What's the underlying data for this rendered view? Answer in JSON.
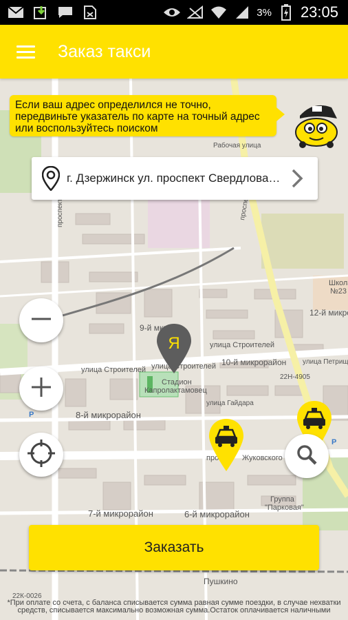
{
  "status_bar": {
    "battery": "3%",
    "time": "23:05",
    "icons": [
      "mail-icon",
      "download-icon",
      "sms-icon",
      "sim-icon",
      "eye-icon",
      "no-signal-icon",
      "wifi-icon",
      "signal-icon",
      "battery-charging-icon"
    ]
  },
  "app_bar": {
    "title": "Заказ такси",
    "menu_icon": "menu-icon"
  },
  "hint": {
    "lines": [
      "Если ваш адрес определился не точно,",
      "передвиньте указатель по карте на точный адрес",
      "или воспользуйтесь поиском"
    ]
  },
  "address": {
    "value": "г. Дзержинск ул. проспект Свердлова…"
  },
  "pin": {
    "letter": "Я"
  },
  "map_labels": {
    "street_stroiteley_1": "улица Строителей",
    "street_stroiteley_2": "улица Строителей",
    "street_stroiteley_3": "улица Строителей",
    "district_8": "8-й микрорайон",
    "district_7": "7-й микрорайон",
    "district_6": "6-й микрорайон",
    "district_9": "9-й мкр",
    "district_10": "10-й микрорайон",
    "district_12": "12-й микро",
    "stadium_1": "Стадион",
    "stadium_2": "Капролактамовец",
    "school_1": "Школа",
    "school_2": "№23",
    "group": "Группа",
    "group_name": "\"Парковая\"",
    "pushkino": "Пушкино",
    "road_22n_4905": "22Н-4905",
    "road_22k_0026": "22К-0026",
    "street_gaidara": "улица Гайдара",
    "street_petrishcheva": "улица Петрищева",
    "street_rabochaya": "Рабочая улица",
    "prospekt_left": "проспект",
    "prospekt_bottom": "просп",
    "prospekt_right": "проспект",
    "zhukovskogo": "Жуковского"
  },
  "buttons": {
    "zoom_out": "zoom-out-icon",
    "zoom_in": "zoom-in-icon",
    "locate": "crosshair-icon",
    "search": "search-icon"
  },
  "order": {
    "label": "Заказать"
  },
  "footnote": {
    "line1": "*При оплате со счета, с баланса списывается сумма равная сумме поездки, в случае нехватки",
    "line2": "средств, списывается максимально возможная сумма.Остаток оплачивается наличными"
  },
  "colors": {
    "accent": "#ffe100",
    "map_bg": "#e8e4dc",
    "building": "#d9d0c9",
    "pin": "#5d5d5d"
  }
}
